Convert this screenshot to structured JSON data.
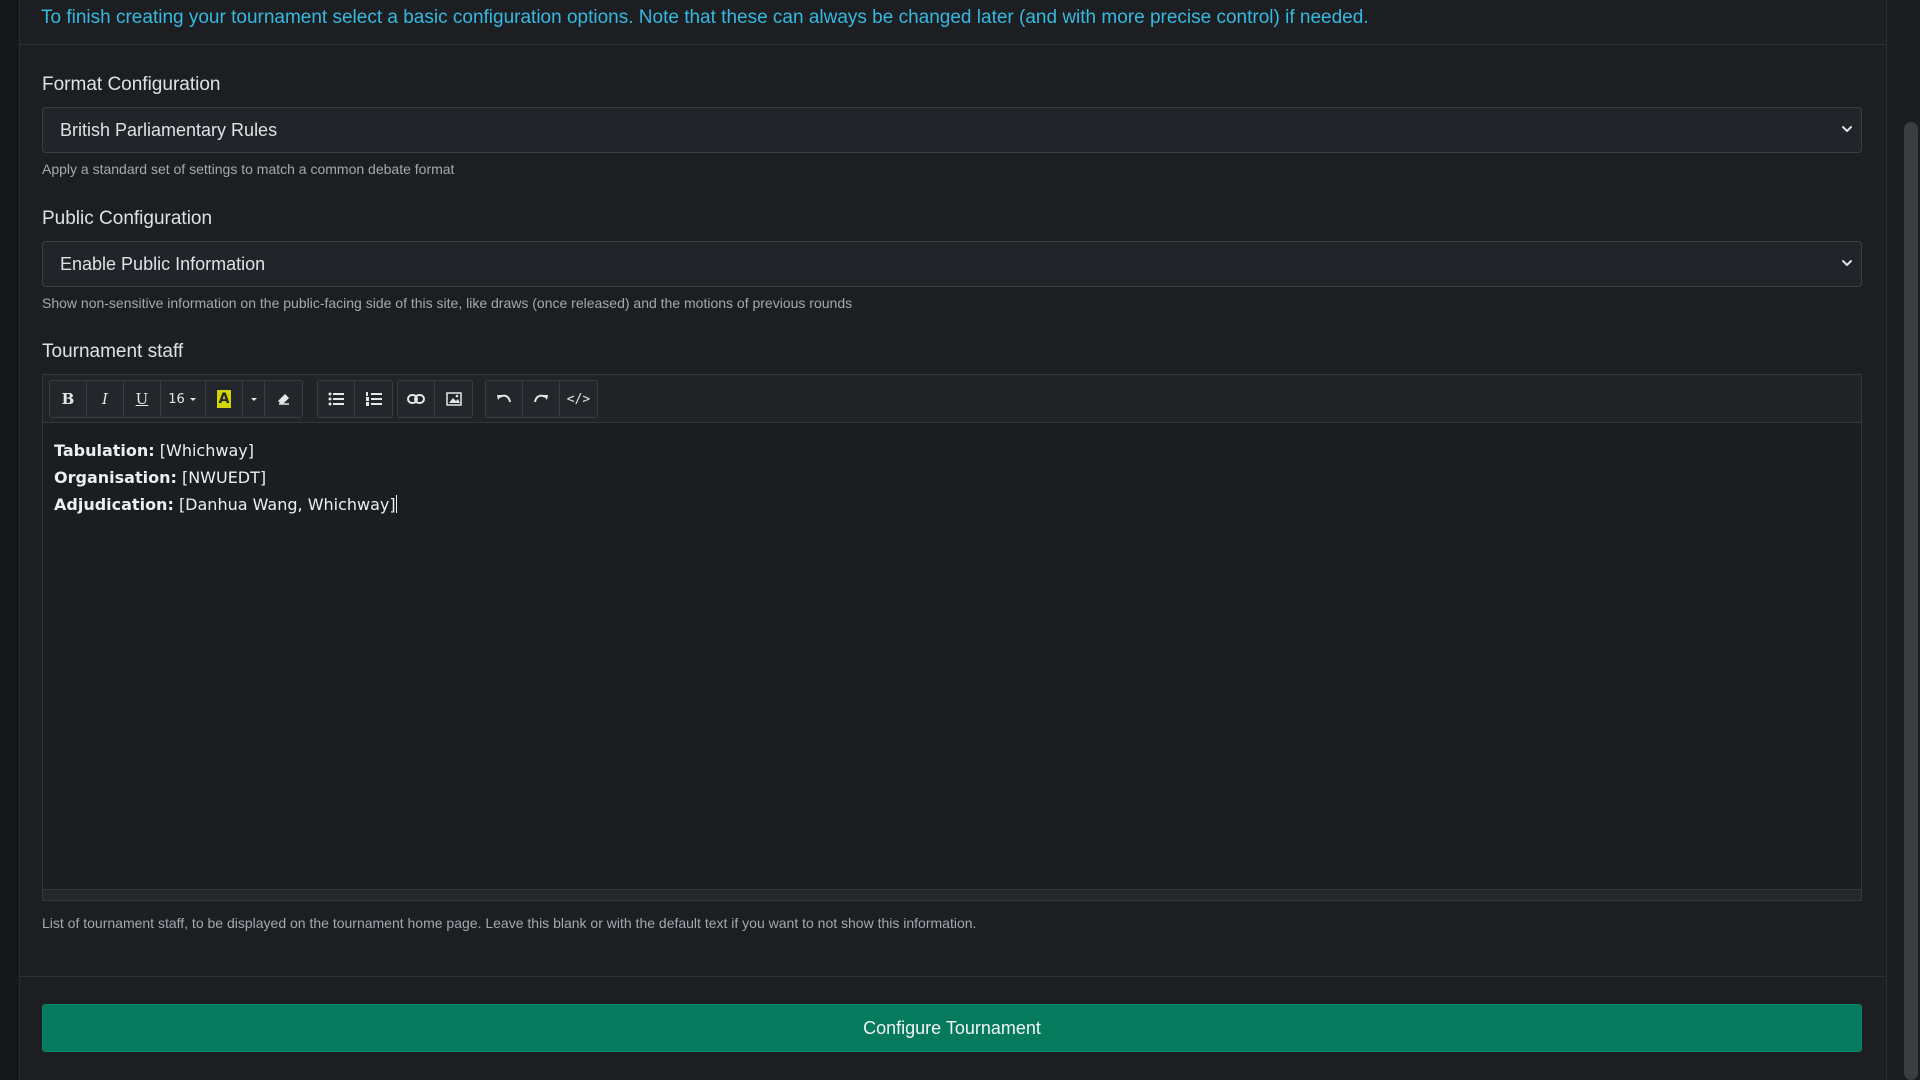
{
  "intro": "To finish creating your tournament select a basic configuration options. Note that these can always be changed later (and with more precise control) if needed.",
  "format": {
    "label": "Format Configuration",
    "value": "British Parliamentary Rules",
    "help": "Apply a standard set of settings to match a common debate format"
  },
  "public": {
    "label": "Public Configuration",
    "value": "Enable Public Information",
    "help": "Show non-sensitive information on the public-facing side of this site, like draws (once released) and the motions of previous rounds"
  },
  "staff": {
    "label": "Tournament staff",
    "toolbar": {
      "bold": "B",
      "italic": "I",
      "underline": "U",
      "font_size": "16",
      "color_letter": "A",
      "highlight_color": "#d4d400",
      "code": "</>"
    },
    "lines": [
      {
        "key": "Tabulation:",
        "value": "[Whichway]"
      },
      {
        "key": "Organisation:",
        "value": "[NWUEDT]"
      },
      {
        "key": "Adjudication:",
        "value": "[Danhua Wang, Whichway]"
      }
    ],
    "help": "List of tournament staff, to be displayed on the tournament home page. Leave this blank or with the default text if you want to not show this information."
  },
  "submit_label": "Configure Tournament",
  "colors": {
    "accent_text": "#35b9e0",
    "submit_bg": "#067a5c",
    "background": "#1b1d1f"
  }
}
